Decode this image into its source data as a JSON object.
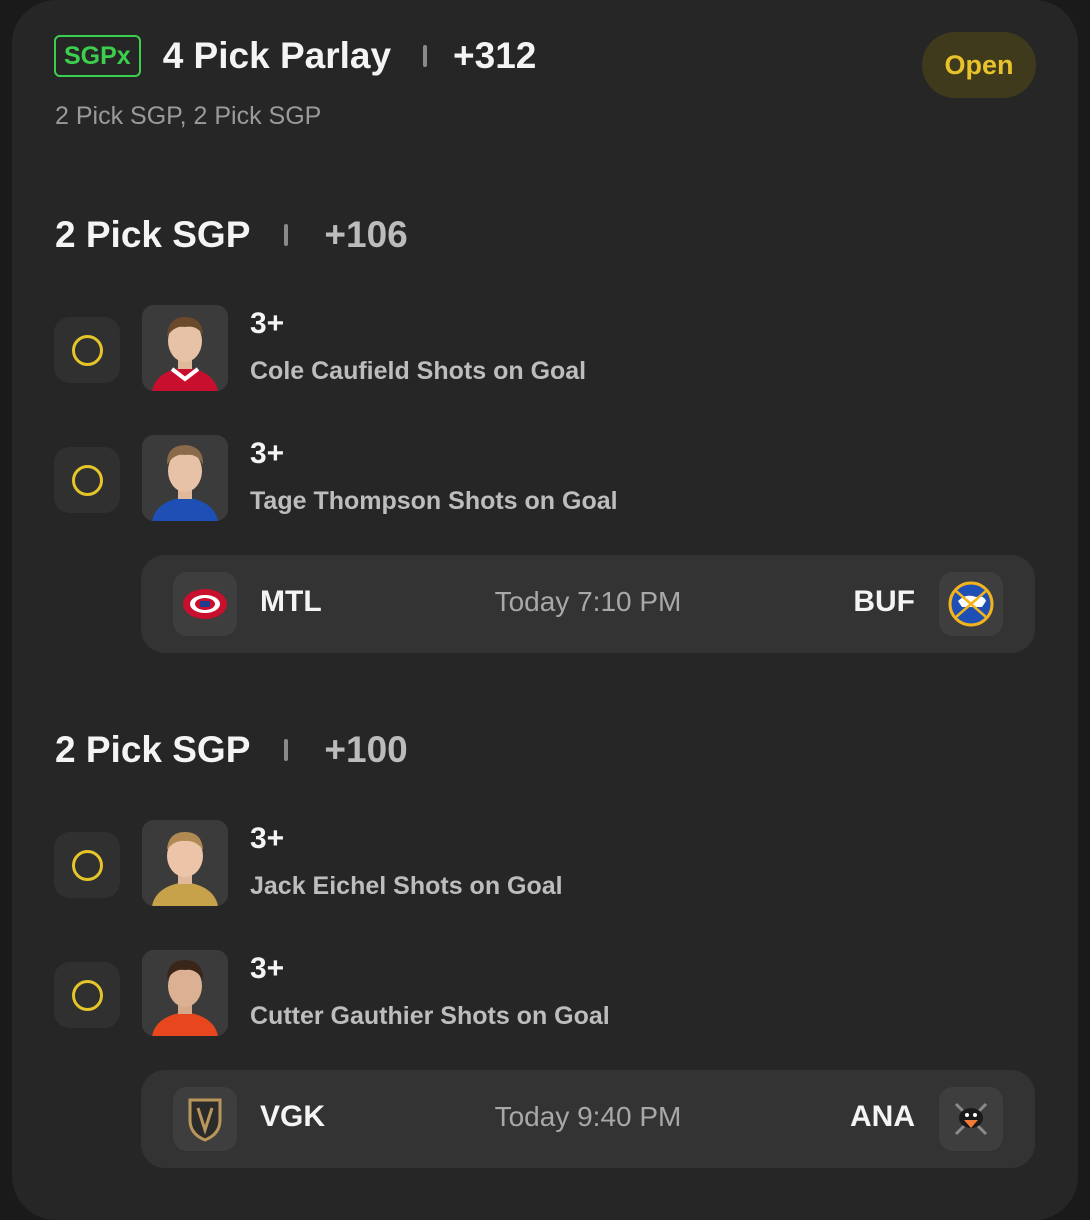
{
  "parlay": {
    "badge": "SGPx",
    "title": "4 Pick Parlay",
    "odds": "+312",
    "status": "Open",
    "subtitle": "2 Pick SGP, 2 Pick SGP"
  },
  "sections": [
    {
      "title": "2 Pick SGP",
      "odds": "+106",
      "legs": [
        {
          "line": "3+",
          "desc": "Cole Caufield Shots on Goal",
          "jersey_color": "#c8102e"
        },
        {
          "line": "3+",
          "desc": "Tage Thompson Shots on Goal",
          "jersey_color": "#1d4fb5"
        }
      ],
      "game": {
        "away": "MTL",
        "time": "Today 7:10 PM",
        "home": "BUF",
        "away_logo": "canadiens-logo-icon",
        "home_logo": "sabres-logo-icon"
      }
    },
    {
      "title": "2 Pick SGP",
      "odds": "+100",
      "legs": [
        {
          "line": "3+",
          "desc": "Jack Eichel Shots on Goal",
          "jersey_color": "#c8a24a"
        },
        {
          "line": "3+",
          "desc": "Cutter Gauthier Shots on Goal",
          "jersey_color": "#e8461c"
        }
      ],
      "game": {
        "away": "VGK",
        "time": "Today 9:40 PM",
        "home": "ANA",
        "away_logo": "golden-knights-logo-icon",
        "home_logo": "ducks-logo-icon"
      }
    }
  ],
  "colors": {
    "accent_green": "#3ccf4e",
    "accent_yellow": "#e5c52a",
    "card_bg": "#262626"
  }
}
